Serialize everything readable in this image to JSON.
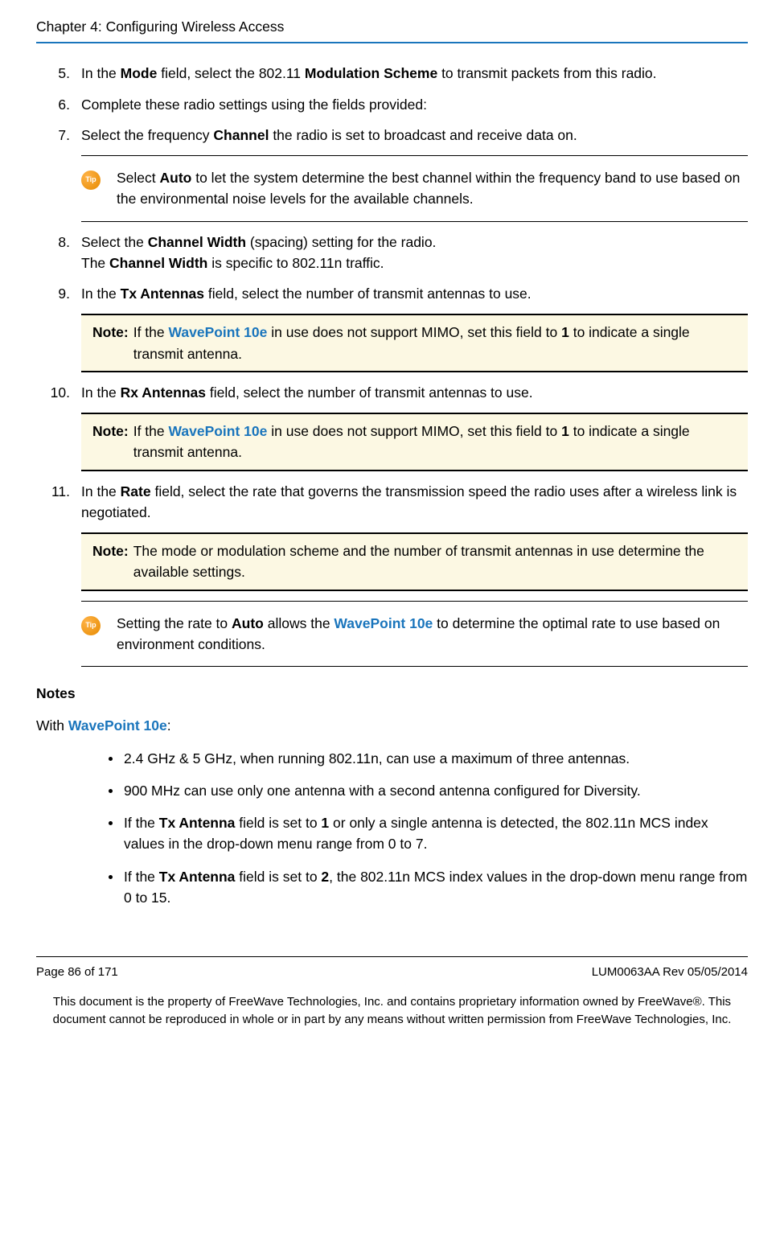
{
  "header": {
    "chapter": "Chapter 4: Configuring Wireless Access"
  },
  "steps": {
    "s5": {
      "num": "5.",
      "pre": "In the ",
      "t1": "Mode",
      "mid1": " field, select the 802.11 ",
      "t2": "Modulation Scheme",
      "post": " to transmit packets from this radio."
    },
    "s6": {
      "num": "6.",
      "text": "Complete these radio settings using the fields provided:"
    },
    "s7": {
      "num": "7.",
      "pre": "Select the frequency ",
      "t1": "Channel",
      "post": " the radio is set to broadcast and receive data on."
    },
    "tip1": {
      "pre": "Select ",
      "t1": "Auto",
      "post": " to let the system determine the best channel within the frequency band to use based on the environmental noise levels for the available channels."
    },
    "s8": {
      "num": "8.",
      "pre": "Select the ",
      "t1": "Channel Width",
      "post": " (spacing) setting for the radio.",
      "line2_pre": "The",
      "line2_b": " Channel Width ",
      "line2_post": "is specific to 802.11n traffic."
    },
    "s9": {
      "num": "9.",
      "pre": "In the ",
      "t1": "Tx Antennas",
      "post": " field, select the number of transmit antennas to use."
    },
    "note1": {
      "label": "Note:",
      "pre": " If the ",
      "link": "WavePoint 10e",
      "mid": " in use does not support MIMO, set this field to ",
      "b1": "1",
      "post": " to indicate a single transmit antenna."
    },
    "s10": {
      "num": "10.",
      "pre": "In the ",
      "t1": "Rx Antennas",
      "post": " field, select the number of transmit antennas to use."
    },
    "note2": {
      "label": "Note:",
      "pre": " If the ",
      "link": "WavePoint 10e",
      "mid": " in use does not support MIMO, set this field to ",
      "b1": "1",
      "post": " to indicate a single transmit antenna."
    },
    "s11": {
      "num": "11.",
      "pre": "In the ",
      "t1": "Rate",
      "post": " field, select the rate that governs the transmission speed the radio uses after a wireless link is negotiated."
    },
    "note3": {
      "label": "Note:",
      "text": " The mode or modulation scheme and the number of transmit antennas in use determine the available settings."
    },
    "tip2": {
      "pre": "Setting the rate to ",
      "t1": "Auto",
      "mid": " allows the ",
      "link": "WavePoint 10e",
      "post": " to determine the optimal rate to use based on environment conditions."
    }
  },
  "notes_section": {
    "heading": "Notes",
    "with_pre": "With ",
    "with_link": "WavePoint 10e",
    "with_post": ":",
    "bullets": {
      "b1": "2.4 GHz & 5 GHz, when running 802.11n, can use a maximum of three antennas.",
      "b2": "900 MHz can use only one antenna with a second antenna configured for Diversity.",
      "b3_pre": "If the ",
      "b3_b1": "Tx Antenna",
      "b3_mid1": " field is set to ",
      "b3_b2": "1",
      "b3_post": " or only a single antenna is detected, the 802.11n MCS index values in the drop-down menu range from 0 to 7.",
      "b4_pre": "If the ",
      "b4_b1": "Tx Antenna",
      "b4_mid1": " field is set to ",
      "b4_b2": "2",
      "b4_post": ", the 802.11n MCS index values in the drop-down menu range from 0 to 15."
    }
  },
  "footer": {
    "left": "Page 86 of 171",
    "right": "LUM0063AA Rev 05/05/2014",
    "legal": "This document is the property of FreeWave Technologies, Inc. and contains proprietary information owned by FreeWave®. This document cannot be reproduced in whole or in part by any means without written permission from FreeWave Technologies, Inc."
  },
  "icon_labels": {
    "tip": "Tip"
  }
}
